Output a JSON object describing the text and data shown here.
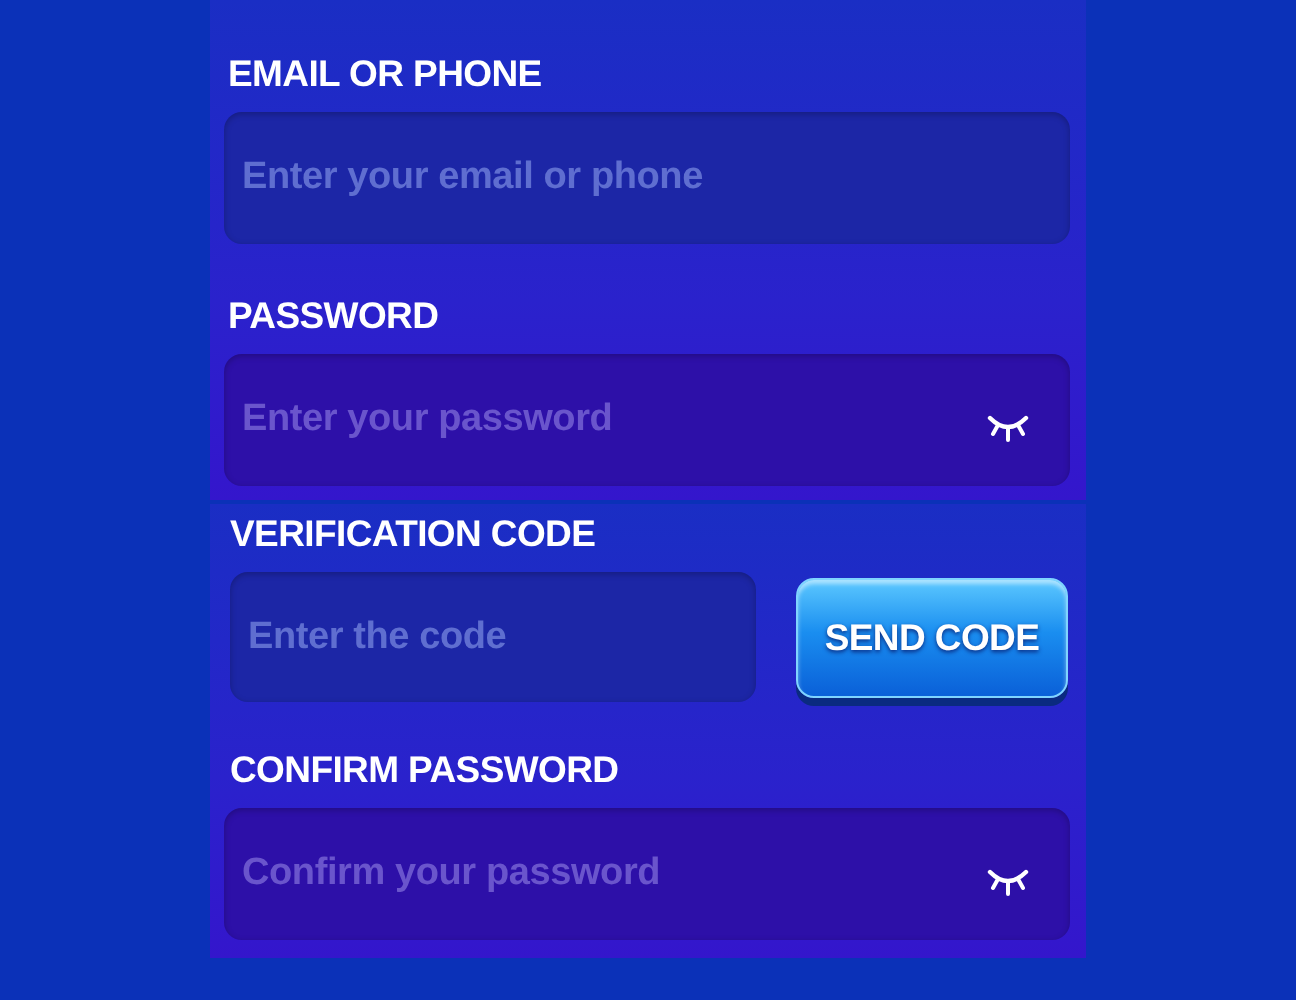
{
  "sections": [
    {
      "fields": [
        {
          "kind": "text",
          "label": "EMAIL OR PHONE",
          "placeholder": "Enter your email or phone"
        },
        {
          "kind": "password",
          "label": "PASSWORD",
          "placeholder": "Enter your password",
          "revealed": false
        }
      ]
    },
    {
      "fields": [
        {
          "kind": "code",
          "label": "VERIFICATION CODE",
          "placeholder": "Enter the code",
          "button": "SEND CODE"
        },
        {
          "kind": "password",
          "label": "CONFIRM PASSWORD",
          "placeholder": "Confirm your password",
          "revealed": false
        }
      ]
    }
  ]
}
